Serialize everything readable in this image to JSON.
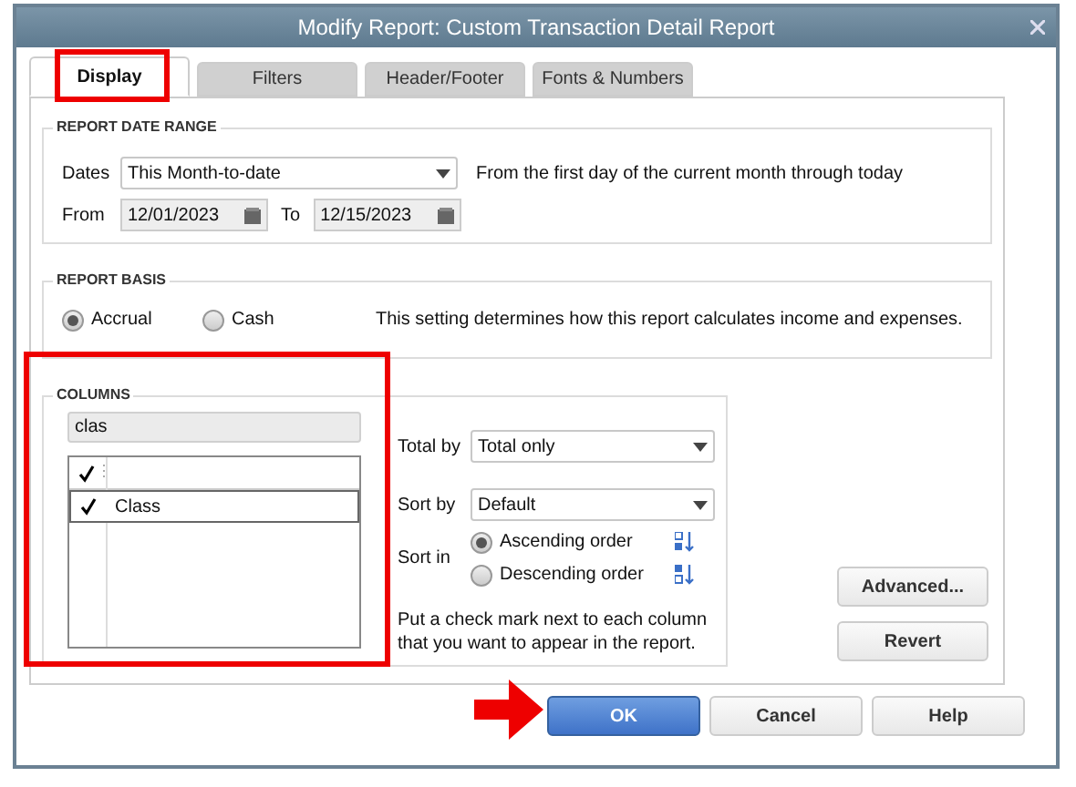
{
  "window": {
    "title": "Modify Report: Custom Transaction Detail Report"
  },
  "tabs": [
    {
      "label": "Display",
      "selected": true
    },
    {
      "label": "Filters",
      "selected": false
    },
    {
      "label": "Header/Footer",
      "selected": false
    },
    {
      "label": "Fonts & Numbers",
      "selected": false
    }
  ],
  "date_range": {
    "heading": "REPORT DATE RANGE",
    "dates_label": "Dates",
    "dates_value": "This Month-to-date",
    "description": "From the first day of the current month through today",
    "from_label": "From",
    "from_value": "12/01/2023",
    "to_label": "To",
    "to_value": "12/15/2023"
  },
  "basis": {
    "heading": "REPORT BASIS",
    "options": [
      {
        "label": "Accrual",
        "selected": true
      },
      {
        "label": "Cash",
        "selected": false
      }
    ],
    "description": "This setting determines how this report calculates income and expenses."
  },
  "columns": {
    "heading": "COLUMNS",
    "search": {
      "value": "clas"
    },
    "header": {
      "checked": true
    },
    "rows": [
      {
        "label": "Class",
        "checked": true
      }
    ]
  },
  "total_by": {
    "label": "Total by",
    "value": "Total only"
  },
  "sort_by": {
    "label": "Sort by",
    "value": "Default"
  },
  "sort_in": {
    "label": "Sort in",
    "options": [
      {
        "label": "Ascending order",
        "selected": true
      },
      {
        "label": "Descending order",
        "selected": false
      }
    ]
  },
  "note": "Put a check mark next to each column that you want to appear in the report.",
  "side_buttons": [
    "Advanced...",
    "Revert"
  ],
  "buttons": [
    {
      "label": "OK",
      "primary": true
    },
    {
      "label": "Cancel",
      "primary": false
    },
    {
      "label": "Help",
      "primary": false
    }
  ]
}
